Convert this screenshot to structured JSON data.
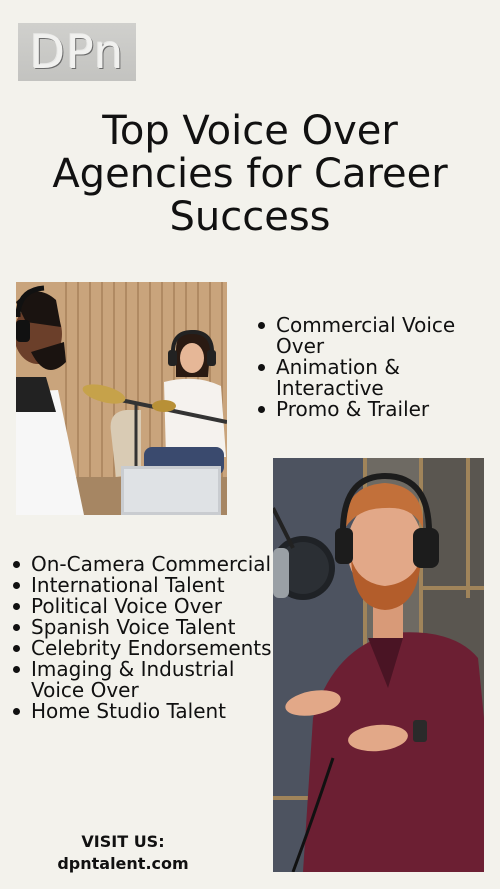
{
  "logo": {
    "text": "DPn"
  },
  "title": "Top Voice Over Agencies for Career Success",
  "list_top": [
    "Commercial Voice Over",
    "Animation & Interactive",
    "Promo & Trailer"
  ],
  "list_bottom": [
    "On-Camera Commercial",
    "International Talent",
    "Political Voice Over",
    "Spanish Voice Talent",
    "Celebrity Endorsements",
    "Imaging & Industrial Voice Over",
    "Home Studio Talent"
  ],
  "visit": {
    "label": "VISIT US:",
    "url": "dpntalent.com"
  },
  "colors": {
    "background": "#f3f2ec",
    "text": "#111111",
    "logo_bg": "#c9c9c6"
  }
}
